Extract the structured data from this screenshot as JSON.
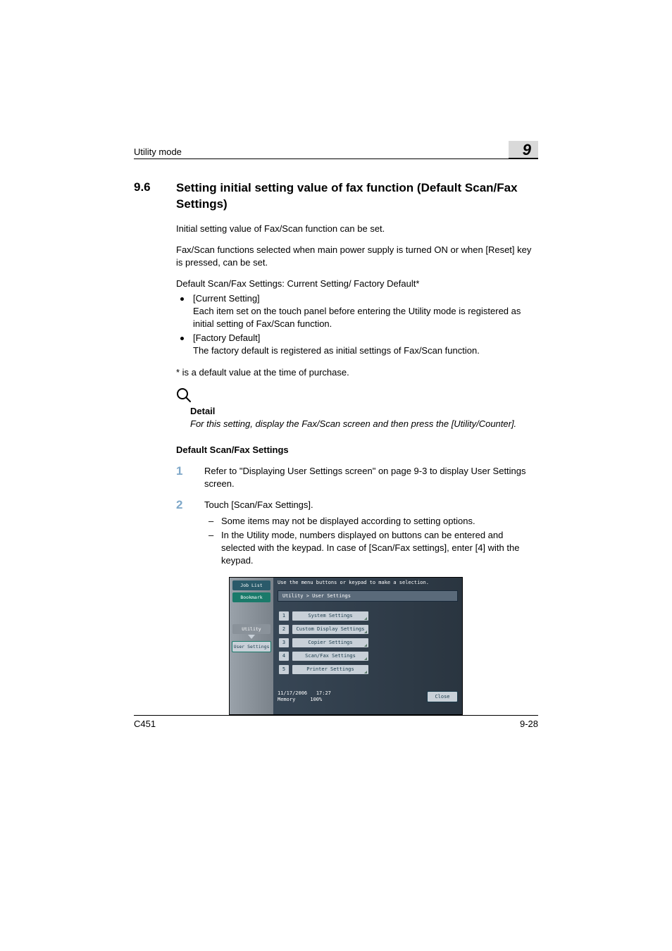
{
  "header": {
    "left": "Utility mode",
    "chapter": "9"
  },
  "section": {
    "number": "9.6",
    "title": "Setting initial setting value of fax function (Default Scan/Fax Settings)"
  },
  "intro": {
    "p1": "Initial setting value of Fax/Scan function can be set.",
    "p2": "Fax/Scan functions selected when main power supply is turned ON or when [Reset] key is pressed, can be set.",
    "p3": "Default Scan/Fax Settings: Current Setting/ Factory Default*"
  },
  "bullets": [
    {
      "head": "[Current Setting]",
      "body": "Each item set on the touch panel before entering the Utility mode is registered as initial setting of Fax/Scan function."
    },
    {
      "head": "[Factory Default]",
      "body": "The factory default is registered as initial settings of Fax/Scan function."
    }
  ],
  "footnote": "* is a default value at the time of purchase.",
  "detail": {
    "label": "Detail",
    "text": "For this setting, display the Fax/Scan screen and then press the [Utility/Counter]."
  },
  "subheading": "Default Scan/Fax Settings",
  "steps": [
    {
      "num": "1",
      "text": "Refer to \"Displaying User Settings screen\" on page 9-3 to display User Settings screen.",
      "subs": []
    },
    {
      "num": "2",
      "text": "Touch [Scan/Fax Settings].",
      "subs": [
        "Some items may not be displayed according to setting options.",
        "In the Utility mode, numbers displayed on buttons can be entered and selected with the keypad. In case of [Scan/Fax settings], enter [4] with the keypad."
      ]
    }
  ],
  "screenshot": {
    "instruction": "Use the menu buttons or keypad to make a selection.",
    "left_tabs": {
      "job_list": "Job List",
      "bookmark": "Bookmark",
      "utility": "Utility",
      "user_settings": "User Settings"
    },
    "breadcrumb": "Utility > User Settings",
    "menu": [
      {
        "n": "1",
        "label": "System Settings"
      },
      {
        "n": "2",
        "label": "Custom Display Settings"
      },
      {
        "n": "3",
        "label": "Copier Settings"
      },
      {
        "n": "4",
        "label": "Scan/Fax Settings"
      },
      {
        "n": "5",
        "label": "Printer Settings"
      }
    ],
    "status": {
      "date": "11/17/2006",
      "time": "17:27",
      "mem_label": "Memory",
      "mem_val": "100%"
    },
    "close": "Close"
  },
  "footer": {
    "left": "C451",
    "right": "9-28"
  }
}
